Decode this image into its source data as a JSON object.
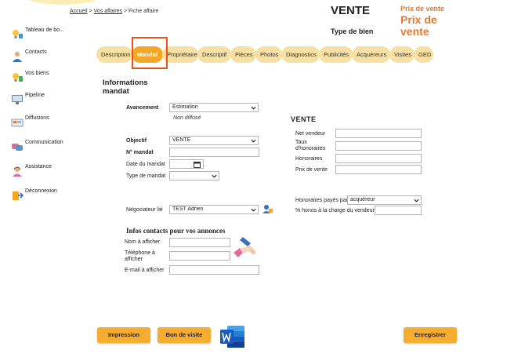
{
  "breadcrumb": {
    "home": "Accueil",
    "sep": ">",
    "affaires": "Vos affaires",
    "current": "Fiche affaire"
  },
  "header": {
    "type": "VENTE",
    "type_bien_label": "Type de bien",
    "prix_label": "Prix de vente",
    "prix_big": "Prix de vente"
  },
  "sidebar": {
    "items": [
      {
        "label": "Tableau de bo...",
        "icon": "lightbulb-icon"
      },
      {
        "label": "Contacts",
        "icon": "person-icon"
      },
      {
        "label": "Vos biens",
        "icon": "lightbulb-icon"
      },
      {
        "label": "Pipeline",
        "icon": "monitor-icon"
      },
      {
        "label": "Diffusions",
        "icon": "diffusion-icon"
      },
      {
        "label": "Communication",
        "icon": "chat-icon"
      },
      {
        "label": "Assistance",
        "icon": "support-icon"
      },
      {
        "label": "Déconnexion",
        "icon": "logout-icon"
      }
    ]
  },
  "tabs": [
    {
      "label": "Description"
    },
    {
      "label": "Mandat"
    },
    {
      "label": "Propriétaire"
    },
    {
      "label": "Descriptif"
    },
    {
      "label": "Pièces"
    },
    {
      "label": "Photos"
    },
    {
      "label": "Diagnostics"
    },
    {
      "label": "Publicités"
    },
    {
      "label": "Acquéreurs"
    },
    {
      "label": "Visites"
    },
    {
      "label": "GED"
    }
  ],
  "active_tab": "Mandat",
  "mandat": {
    "title": "Informations mandat",
    "avancement_label": "Avancement",
    "avancement_value": "Estimation",
    "diffusion_status": "Non diffusé",
    "objectif_label": "Objectif",
    "objectif_value": "VENTE",
    "numero_label": "N° mandat",
    "numero_value": "",
    "date_label": "Date du mandat",
    "date_value": "",
    "type_label": "Type de mandat",
    "type_value": "",
    "negociateur_label": "Négociateur lié",
    "negociateur_value": "TEST Adrien"
  },
  "vente": {
    "title": "VENTE",
    "net_vendeur_label": "Net vendeur",
    "net_vendeur_value": "",
    "taux_label": "Taux d'honoraires",
    "taux_value": "",
    "honoraires_label": "Honoraires",
    "honoraires_value": "",
    "prix_label": "Prix de vente",
    "prix_value": "",
    "payes_par_label": "Honoraires payés par",
    "payes_par_value": "acquéreur",
    "honos_vendeur_label": "% honos à la charge du vendeur",
    "honos_vendeur_value": ""
  },
  "contacts": {
    "title": "Infos contacts pour vos annonces",
    "nom_label": "Nom à afficher",
    "nom_value": "",
    "tel_label": "Téléphone à afficher",
    "tel_value": "",
    "email_label": "E-mail à afficher",
    "email_value": ""
  },
  "buttons": {
    "impression": "Impression",
    "bon_visite": "Bon de visite",
    "enregistrer": "Enregistrer"
  },
  "colors": {
    "tab": "#f6e0a3",
    "tab_active": "#f3a727",
    "accent": "#e57a2e",
    "highlight": "#e8541c",
    "button": "#f5ad31",
    "word_blue": "#2b579a"
  }
}
